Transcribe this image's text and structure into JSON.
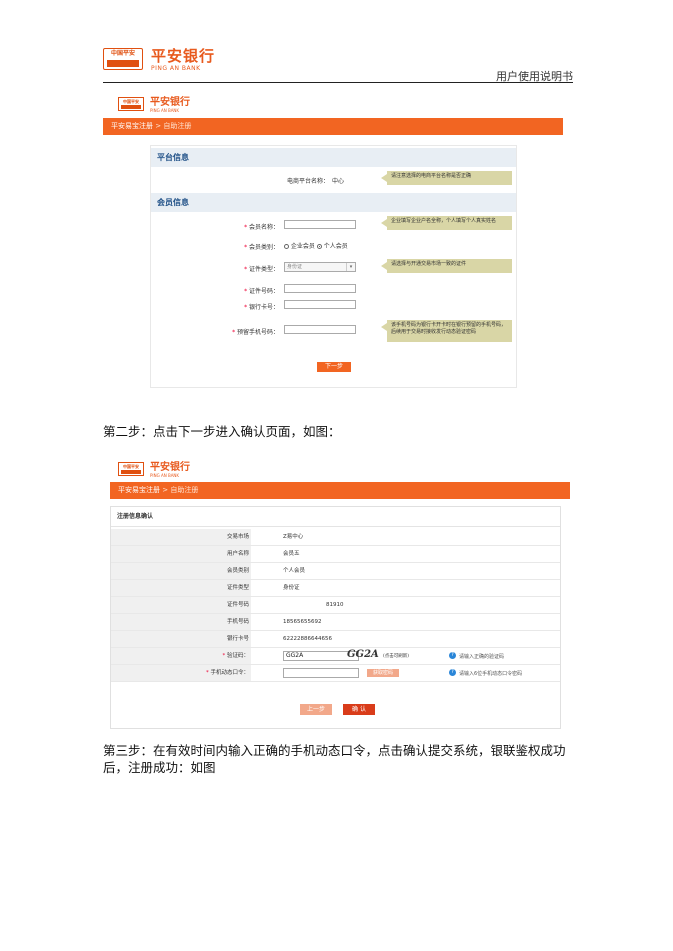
{
  "header": {
    "logo_badge": "中国平安",
    "logo_cn": "平安银行",
    "logo_en": "PING AN BANK",
    "doc_title": "用户使用说明书"
  },
  "shot1": {
    "logo_cn": "平安银行",
    "logo_en": "PING AN BANK",
    "badge": "中国平安",
    "bar_title": "平安易宝注册",
    "bar_sub": "> 自助注册",
    "platform_section": "平台信息",
    "member_section": "会员信息",
    "platform_label": "电商平台名称：",
    "platform_value": "中心",
    "platform_hint": "请注意选择的电商平台名称是否正确",
    "member_name_label": "会员名称：",
    "member_name_hint": "企业填写企业户名全称，个人填写个人真实姓名",
    "member_type_label": "会员类别：",
    "member_type_opt1": "企业会员",
    "member_type_opt2": "个人会员",
    "id_type_label": "证件类型：",
    "id_type_value": "身份证",
    "id_type_hint": "请选择与开通交易市场一致的证件",
    "id_no_label": "证件号码：",
    "card_no_label": "银行卡号：",
    "phone_label": "预留手机号码：",
    "phone_hint": "该手机号码为银行卡开卡时在银行预留的手机号码，后续用于交易时接收发行动态验证密码",
    "next_btn": "下一步"
  },
  "step2_text": "第二步：点击下一步进入确认页面，如图：",
  "shot2": {
    "logo_cn": "平安银行",
    "logo_en": "PING AN BANK",
    "badge": "中国平安",
    "bar_title": "平安易宝注册",
    "bar_sub": "> 自助注册",
    "confirm_title": "注册信息确认",
    "rows": [
      {
        "k": "交易市场",
        "v": "Z易中心"
      },
      {
        "k": "用户名称",
        "v": "会员五"
      },
      {
        "k": "会员类别",
        "v": "个人会员"
      },
      {
        "k": "证件类型",
        "v": "身份证"
      },
      {
        "k": "证件号码",
        "v": "81910"
      },
      {
        "k": "手机号码",
        "v": "18565655692"
      },
      {
        "k": "银行卡号",
        "v": "62222886644656"
      }
    ],
    "captcha_label": "验证码：",
    "captcha_input": "GG2A",
    "captcha_image": "GG2A",
    "captcha_note": "(点击可刷新)",
    "captcha_hint": "请输入正确的验证码",
    "otp_label": "手机动态口令：",
    "otp_btn": "获取密码",
    "otp_hint": "请输入6位手机动态口令密码",
    "prev_btn": "上一步",
    "ok_btn": "确 认"
  },
  "step3_text": "第三步：在有效时间内输入正确的手机动态口令，点击确认提交系统，银联鉴权成功后，注册成功：如图",
  "colors": {
    "brand_orange": "#f26522",
    "section_blue": "#1e4f86",
    "hint_bg": "#d9d6a6"
  }
}
